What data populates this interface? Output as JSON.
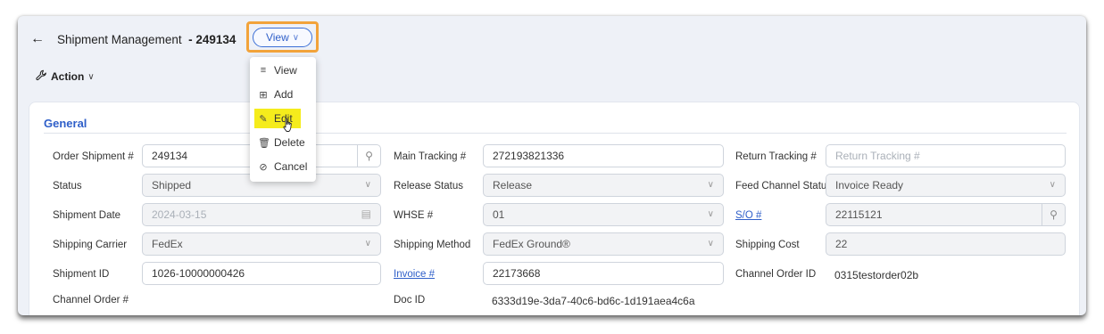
{
  "header": {
    "title": "Shipment Management",
    "separator": "-",
    "record_id": "249134",
    "view_button": "View",
    "action_label": "Action"
  },
  "menu": {
    "items": [
      {
        "label": "View",
        "icon": "list-icon"
      },
      {
        "label": "Add",
        "icon": "add-file-icon"
      },
      {
        "label": "Edit",
        "icon": "pencil-icon"
      },
      {
        "label": "Delete",
        "icon": "trash-icon"
      },
      {
        "label": "Cancel",
        "icon": "cancel-icon"
      }
    ],
    "highlight_color": "#f5ec1c"
  },
  "general": {
    "section_title": "General",
    "order_shipment_label": "Order Shipment #",
    "order_shipment_value": "249134",
    "status_label": "Status",
    "status_value": "Shipped",
    "shipment_date_label": "Shipment Date",
    "shipment_date_value": "2024-03-15",
    "shipping_carrier_label": "Shipping Carrier",
    "shipping_carrier_value": "FedEx",
    "shipment_id_label": "Shipment ID",
    "shipment_id_value": "1026-10000000426",
    "channel_order_label": "Channel Order #",
    "main_tracking_label": "Main Tracking #",
    "main_tracking_value": "272193821336",
    "release_status_label": "Release Status",
    "release_status_value": "Release",
    "whse_label": "WHSE #",
    "whse_value": "01",
    "shipping_method_label": "Shipping Method",
    "shipping_method_value": "FedEx Ground®",
    "invoice_label": "Invoice #",
    "invoice_value": "22173668",
    "doc_id_label": "Doc ID",
    "doc_id_value": "6333d19e-3da7-40c6-bd6c-1d191aea4c6a",
    "return_tracking_label": "Return Tracking #",
    "return_tracking_placeholder": "Return Tracking #",
    "feed_channel_status_label": "Feed Channel Status",
    "feed_channel_status_value": "Invoice Ready",
    "so_label": "S/O #",
    "so_value": "22115121",
    "shipping_cost_label": "Shipping Cost",
    "shipping_cost_value": "22",
    "channel_order_id_label": "Channel Order ID",
    "channel_order_id_value": "0315testorder02b"
  },
  "colors": {
    "accent": "#2f5fc9",
    "focus_outline": "#f2a33a"
  }
}
